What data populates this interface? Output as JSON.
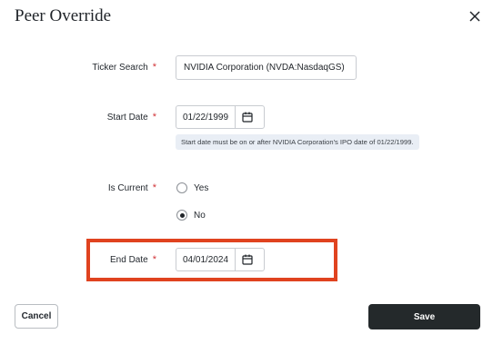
{
  "dialog": {
    "title": "Peer Override"
  },
  "fields": {
    "ticker": {
      "label": "Ticker Search",
      "required_mark": "*",
      "value": "NVIDIA Corporation (NVDA:NasdaqGS)"
    },
    "start_date": {
      "label": "Start Date",
      "required_mark": "*",
      "value": "01/22/1999",
      "hint": "Start date must be on or after NVIDIA Corporation's IPO date of 01/22/1999."
    },
    "is_current": {
      "label": "Is Current",
      "required_mark": "*",
      "options": [
        {
          "label": "Yes",
          "checked": false
        },
        {
          "label": "No",
          "checked": true
        }
      ]
    },
    "end_date": {
      "label": "End Date",
      "required_mark": "*",
      "value": "04/01/2024"
    }
  },
  "buttons": {
    "cancel_label": "Cancel",
    "save_label": "Save"
  },
  "colors": {
    "required_mark": "#d13438",
    "highlight_border": "#e0431f",
    "save_button_bg": "#24292b",
    "hint_bg": "#e9eef5"
  },
  "icons": {
    "close": "close-icon",
    "calendar": "calendar-icon"
  }
}
